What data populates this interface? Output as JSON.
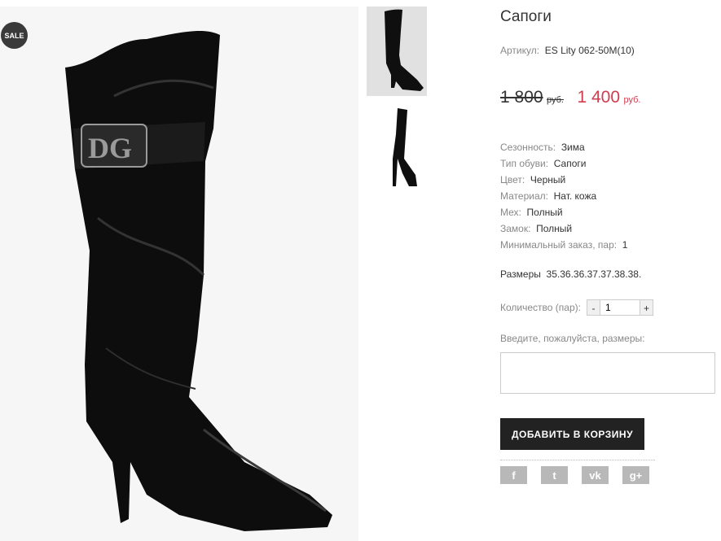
{
  "product": {
    "badge": "SALE",
    "title": "Сапоги",
    "sku_label": "Артикул:",
    "sku": "ES Lity 062-50M(10)",
    "old_price": "1 800",
    "old_currency": "руб.",
    "new_price": "1 400",
    "new_currency": "руб."
  },
  "properties": [
    {
      "label": "Сезонность:",
      "value": "Зима"
    },
    {
      "label": "Тип обуви:",
      "value": "Сапоги"
    },
    {
      "label": "Цвет:",
      "value": "Черный"
    },
    {
      "label": "Материал:",
      "value": "Нат. кожа"
    },
    {
      "label": "Мех:",
      "value": "Полный"
    },
    {
      "label": "Замок:",
      "value": "Полный"
    },
    {
      "label": "Минимальный заказ, пар:",
      "value": "1"
    }
  ],
  "sizes": {
    "label": "Размеры",
    "value": "35.36.36.37.37.38.38."
  },
  "quantity": {
    "label": "Количество (пар):",
    "minus": "-",
    "value": "1",
    "plus": "+"
  },
  "note": {
    "label": "Введите, пожалуйста, размеры:"
  },
  "cart": {
    "button_label": "ДОБАВИТЬ В КОРЗИНУ"
  },
  "social": [
    {
      "name": "facebook-icon",
      "glyph": "f"
    },
    {
      "name": "twitter-icon",
      "glyph": "t"
    },
    {
      "name": "vk-icon",
      "glyph": "vk"
    },
    {
      "name": "google-plus-icon",
      "glyph": "g+"
    }
  ],
  "colors": {
    "accent_price": "#d23c4f",
    "button_bg": "#222222",
    "social_bg": "#b8b8b8",
    "badge_bg": "#3a3a3a"
  }
}
